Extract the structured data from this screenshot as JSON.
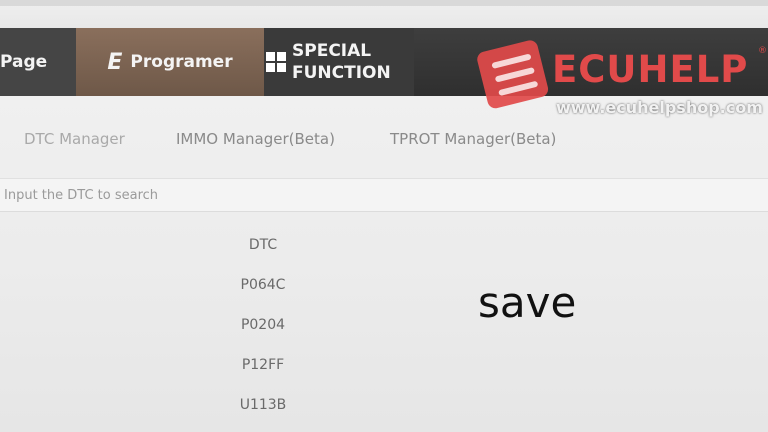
{
  "nav": {
    "page_label": "Page",
    "programer_glyph": "E",
    "programer_label": "Programer",
    "special_line1": "SPECIAL",
    "special_line2": "FUNCTION"
  },
  "brand": {
    "name": "ECUHELP",
    "reg": "®",
    "url": "www.ecuhelpshop.com",
    "accent_color": "#e14a4a"
  },
  "subtabs": [
    {
      "label": "DTC Manager"
    },
    {
      "label": "IMMO Manager(Beta)"
    },
    {
      "label": "TPROT Manager(Beta)"
    }
  ],
  "search": {
    "placeholder": "Input the DTC to search",
    "value": ""
  },
  "dtc_table": {
    "header": "DTC",
    "rows": [
      "P064C",
      "P0204",
      "P12FF",
      "U113B"
    ]
  },
  "caption": "save"
}
